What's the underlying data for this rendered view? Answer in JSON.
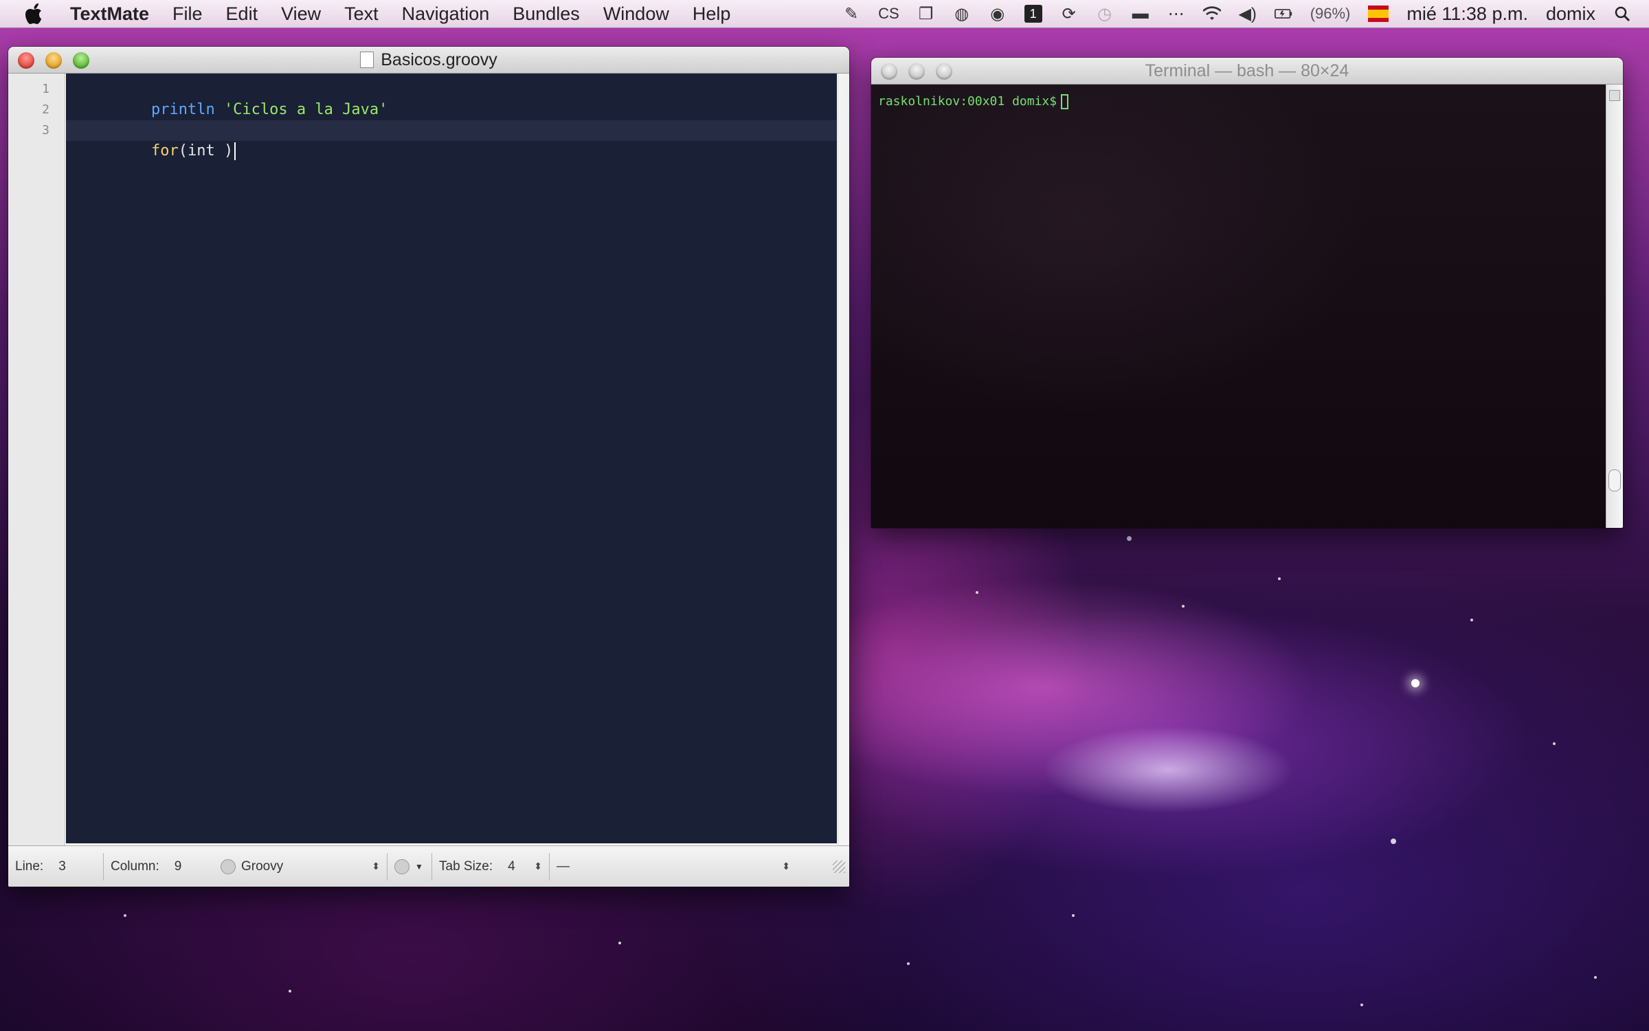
{
  "menubar": {
    "app_name": "TextMate",
    "menus": [
      "File",
      "Edit",
      "View",
      "Text",
      "Navigation",
      "Bundles",
      "Window",
      "Help"
    ],
    "status_cs": "CS",
    "battery": "(96%)",
    "datetime": "mié 11:38 p.m.",
    "user": "domix"
  },
  "textmate": {
    "title": "Basicos.groovy",
    "line_numbers": [
      "1",
      "2",
      "3"
    ],
    "code": {
      "line1_fn": "println",
      "line1_str": "'Ciclos a la Java'",
      "line3_kw": "for",
      "line3_rest": "(int )"
    },
    "status": {
      "line_label": "Line:",
      "line_value": "3",
      "column_label": "Column:",
      "column_value": "9",
      "language": "Groovy",
      "tab_label": "Tab Size:",
      "tab_value": "4",
      "symbol": "—"
    }
  },
  "terminal": {
    "title": "Terminal — bash — 80×24",
    "prompt": "raskolnikov:00x01 domix$"
  },
  "colors": {
    "editor_bg": "#1a2035",
    "function": "#5ea8ff",
    "string": "#9be86c",
    "keyword": "#f4d26a",
    "terminal_text": "#76e070"
  }
}
